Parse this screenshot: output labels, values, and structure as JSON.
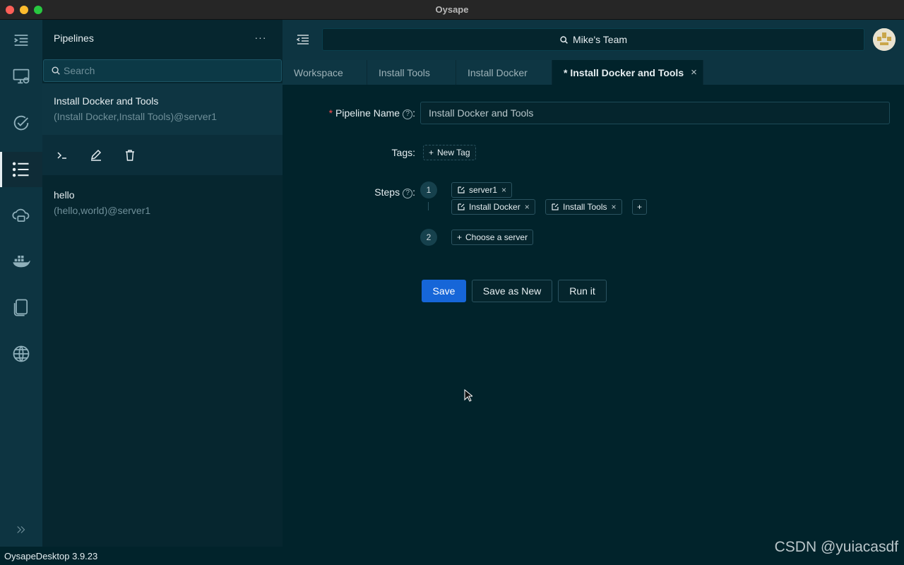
{
  "window": {
    "title": "Oysape"
  },
  "rail": {
    "items": [
      {
        "icon": "menu-collapse-icon"
      },
      {
        "icon": "server-monitor-icon"
      },
      {
        "icon": "task-check-icon"
      },
      {
        "icon": "pipeline-list-icon",
        "active": true
      },
      {
        "icon": "cloud-storage-icon"
      },
      {
        "icon": "docker-icon"
      },
      {
        "icon": "notes-icon"
      },
      {
        "icon": "globe-icon"
      },
      {
        "icon": "expand-chevrons-icon"
      }
    ]
  },
  "list_panel": {
    "title": "Pipelines",
    "more_label": "···",
    "search_placeholder": "Search",
    "items": [
      {
        "name": "Install Docker and Tools",
        "desc": "(Install Docker,Install Tools)@server1",
        "selected": true
      },
      {
        "name": "hello",
        "desc": "(hello,world)@server1"
      }
    ]
  },
  "topbar": {
    "team": "Mike's Team"
  },
  "tabs": [
    {
      "label": "Workspace"
    },
    {
      "label": "Install Tools"
    },
    {
      "label": "Install Docker"
    },
    {
      "label": "* Install Docker and Tools",
      "active": true,
      "close": "×"
    }
  ],
  "form": {
    "required_mark": "*",
    "name_label": "Pipeline Name",
    "name_value": "Install Docker and Tools",
    "help_mark": "?",
    "tags_label": "Tags",
    "new_tag": "New Tag",
    "steps_label": "Steps",
    "steps": [
      {
        "number": "1",
        "server": "server1",
        "tasks": [
          "Install Docker",
          "Install Tools"
        ],
        "add_label": "+"
      },
      {
        "number": "2",
        "choose_server": "Choose a server"
      }
    ],
    "chip_close": "×",
    "plus": "+",
    "colon": ":"
  },
  "buttons": {
    "save": "Save",
    "save_as_new": "Save as New",
    "run": "Run it"
  },
  "status": {
    "version": "OysapeDesktop 3.9.23"
  },
  "watermark": "CSDN @yuiacasdf",
  "colors": {
    "accent": "#1666d8",
    "rail": "#0d3441",
    "main_bg": "#01232b",
    "required": "#ff4d4f"
  }
}
